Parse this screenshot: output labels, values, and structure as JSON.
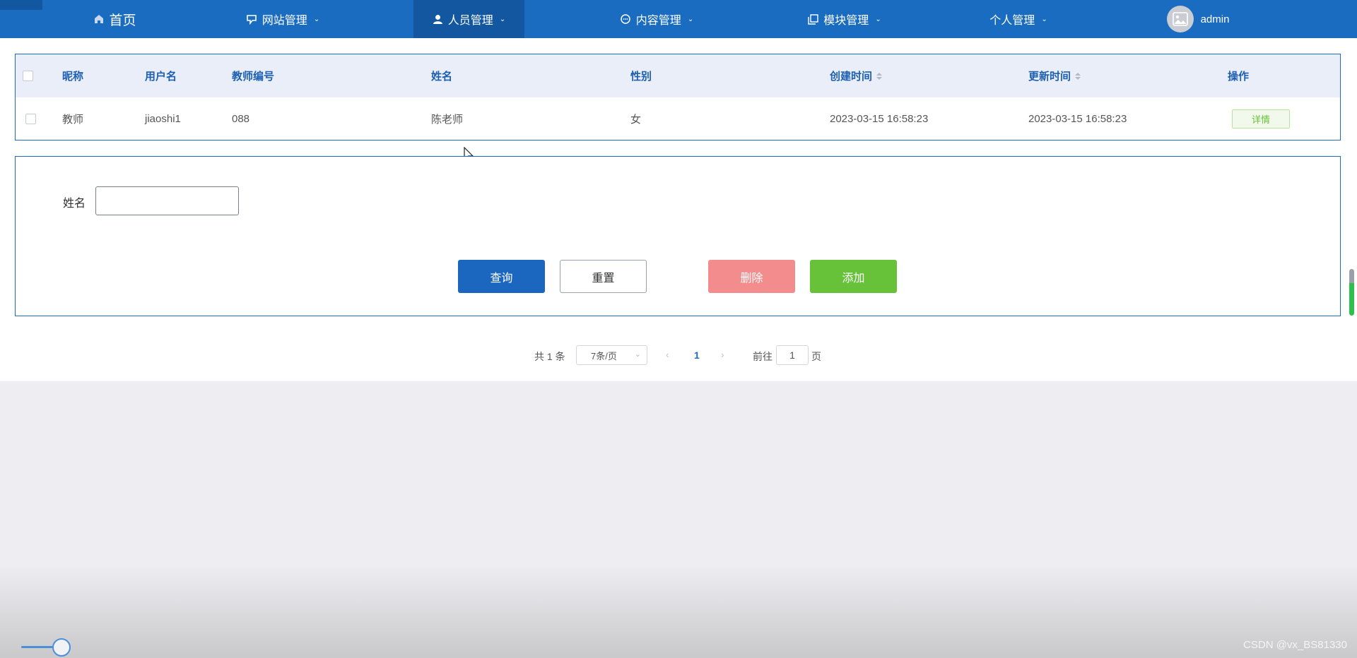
{
  "nav": {
    "items": [
      {
        "label": "首页",
        "icon": "home-icon",
        "has_dropdown": false,
        "active": false
      },
      {
        "label": "网站管理",
        "icon": "website-icon",
        "has_dropdown": true,
        "active": false
      },
      {
        "label": "人员管理",
        "icon": "user-icon",
        "has_dropdown": true,
        "active": true
      },
      {
        "label": "内容管理",
        "icon": "chat-icon",
        "has_dropdown": true,
        "active": false
      },
      {
        "label": "模块管理",
        "icon": "copy-icon",
        "has_dropdown": true,
        "active": false
      },
      {
        "label": "个人管理",
        "icon": "",
        "has_dropdown": true,
        "active": false
      }
    ],
    "user": {
      "name": "admin"
    },
    "colors": {
      "bar": "#1a6cc0",
      "active": "#1257a0"
    }
  },
  "table": {
    "headers": [
      "昵称",
      "用户名",
      "教师编号",
      "姓名",
      "性别",
      "创建时间",
      "更新时间",
      "操作"
    ],
    "rows": [
      {
        "nickname": "教师",
        "username": "jiaoshi1",
        "teacher_no": "088",
        "name": "陈老师",
        "gender": "女",
        "created": "2023-03-15 16:58:23",
        "updated": "2023-03-15 16:58:23",
        "action": "详情"
      }
    ]
  },
  "search": {
    "label": "姓名",
    "value": "",
    "buttons": {
      "query": "查询",
      "reset": "重置",
      "delete": "删除",
      "add": "添加"
    }
  },
  "pagination": {
    "total_text": "共 1 条",
    "page_size": "7条/页",
    "current_page": "1",
    "goto_prefix": "前往",
    "goto_value": "1",
    "goto_suffix": "页"
  },
  "watermark": "CSDN @vx_BS81330"
}
